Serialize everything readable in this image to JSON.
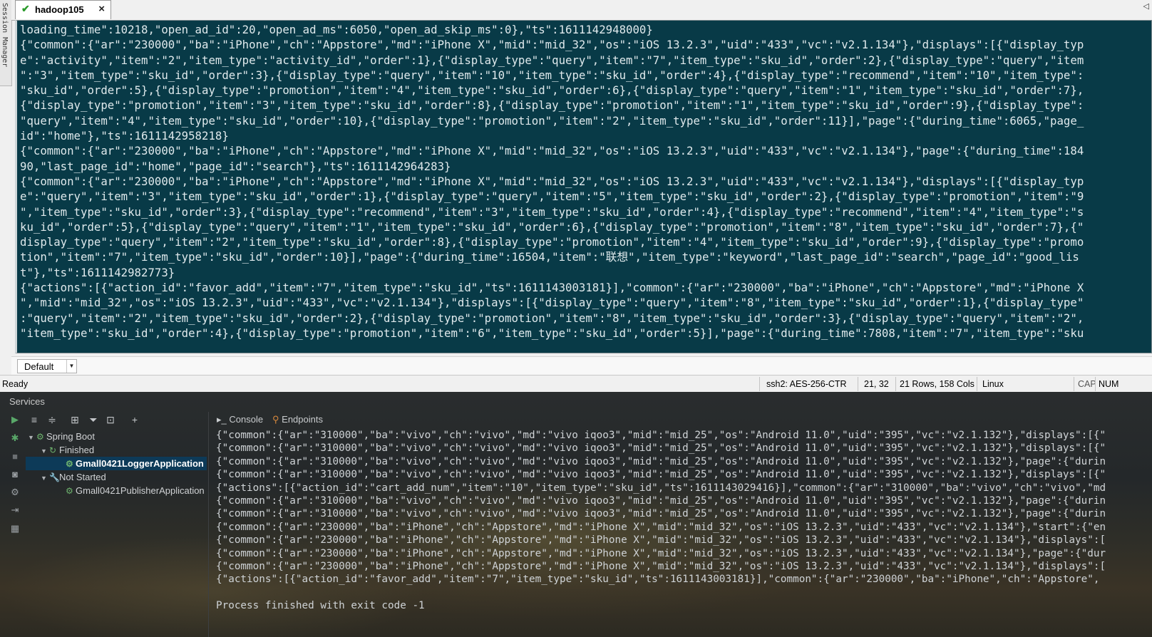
{
  "session_manager": {
    "label": "Session Manager"
  },
  "tab": {
    "title": "hadoop105"
  },
  "terminal": {
    "lines": [
      "loading_time\":10218,\"open_ad_id\":20,\"open_ad_ms\":6050,\"open_ad_skip_ms\":0},\"ts\":1611142948000}",
      "{\"common\":{\"ar\":\"230000\",\"ba\":\"iPhone\",\"ch\":\"Appstore\",\"md\":\"iPhone X\",\"mid\":\"mid_32\",\"os\":\"iOS 13.2.3\",\"uid\":\"433\",\"vc\":\"v2.1.134\"},\"displays\":[{\"display_typ",
      "e\":\"activity\",\"item\":\"2\",\"item_type\":\"activity_id\",\"order\":1},{\"display_type\":\"query\",\"item\":\"7\",\"item_type\":\"sku_id\",\"order\":2},{\"display_type\":\"query\",\"item",
      "\":\"3\",\"item_type\":\"sku_id\",\"order\":3},{\"display_type\":\"query\",\"item\":\"10\",\"item_type\":\"sku_id\",\"order\":4},{\"display_type\":\"recommend\",\"item\":\"10\",\"item_type\":",
      "\"sku_id\",\"order\":5},{\"display_type\":\"promotion\",\"item\":\"4\",\"item_type\":\"sku_id\",\"order\":6},{\"display_type\":\"query\",\"item\":\"1\",\"item_type\":\"sku_id\",\"order\":7},",
      "{\"display_type\":\"promotion\",\"item\":\"3\",\"item_type\":\"sku_id\",\"order\":8},{\"display_type\":\"promotion\",\"item\":\"1\",\"item_type\":\"sku_id\",\"order\":9},{\"display_type\":",
      "\"query\",\"item\":\"4\",\"item_type\":\"sku_id\",\"order\":10},{\"display_type\":\"promotion\",\"item\":\"2\",\"item_type\":\"sku_id\",\"order\":11}],\"page\":{\"during_time\":6065,\"page_",
      "id\":\"home\"},\"ts\":1611142958218}",
      "{\"common\":{\"ar\":\"230000\",\"ba\":\"iPhone\",\"ch\":\"Appstore\",\"md\":\"iPhone X\",\"mid\":\"mid_32\",\"os\":\"iOS 13.2.3\",\"uid\":\"433\",\"vc\":\"v2.1.134\"},\"page\":{\"during_time\":184",
      "90,\"last_page_id\":\"home\",\"page_id\":\"search\"},\"ts\":1611142964283}",
      "{\"common\":{\"ar\":\"230000\",\"ba\":\"iPhone\",\"ch\":\"Appstore\",\"md\":\"iPhone X\",\"mid\":\"mid_32\",\"os\":\"iOS 13.2.3\",\"uid\":\"433\",\"vc\":\"v2.1.134\"},\"displays\":[{\"display_typ",
      "e\":\"query\",\"item\":\"3\",\"item_type\":\"sku_id\",\"order\":1},{\"display_type\":\"query\",\"item\":\"5\",\"item_type\":\"sku_id\",\"order\":2},{\"display_type\":\"promotion\",\"item\":\"9",
      "\",\"item_type\":\"sku_id\",\"order\":3},{\"display_type\":\"recommend\",\"item\":\"3\",\"item_type\":\"sku_id\",\"order\":4},{\"display_type\":\"recommend\",\"item\":\"4\",\"item_type\":\"s",
      "ku_id\",\"order\":5},{\"display_type\":\"query\",\"item\":\"1\",\"item_type\":\"sku_id\",\"order\":6},{\"display_type\":\"promotion\",\"item\":\"8\",\"item_type\":\"sku_id\",\"order\":7},{\"",
      "display_type\":\"query\",\"item\":\"2\",\"item_type\":\"sku_id\",\"order\":8},{\"display_type\":\"promotion\",\"item\":\"4\",\"item_type\":\"sku_id\",\"order\":9},{\"display_type\":\"promo",
      "tion\",\"item\":\"7\",\"item_type\":\"sku_id\",\"order\":10}],\"page\":{\"during_time\":16504,\"item\":\"联想\",\"item_type\":\"keyword\",\"last_page_id\":\"search\",\"page_id\":\"good_lis",
      "t\"},\"ts\":1611142982773}",
      "{\"actions\":[{\"action_id\":\"favor_add\",\"item\":\"7\",\"item_type\":\"sku_id\",\"ts\":1611143003181}],\"common\":{\"ar\":\"230000\",\"ba\":\"iPhone\",\"ch\":\"Appstore\",\"md\":\"iPhone X",
      "\",\"mid\":\"mid_32\",\"os\":\"iOS 13.2.3\",\"uid\":\"433\",\"vc\":\"v2.1.134\"},\"displays\":[{\"display_type\":\"query\",\"item\":\"8\",\"item_type\":\"sku_id\",\"order\":1},{\"display_type\"",
      ":\"query\",\"item\":\"2\",\"item_type\":\"sku_id\",\"order\":2},{\"display_type\":\"promotion\",\"item\":\"8\",\"item_type\":\"sku_id\",\"order\":3},{\"display_type\":\"query\",\"item\":\"2\",",
      "\"item_type\":\"sku_id\",\"order\":4},{\"display_type\":\"promotion\",\"item\":\"6\",\"item_type\":\"sku_id\",\"order\":5}],\"page\":{\"during_time\":7808,\"item\":\"7\",\"item_type\":\"sku"
    ]
  },
  "command_bar": {
    "combo_value": "Default"
  },
  "status_bar": {
    "ready": "Ready",
    "cipher": "ssh2: AES-256-CTR",
    "cursor": "21,  32",
    "size": "21 Rows, 158 Cols",
    "os": "Linux",
    "cap": "CAP",
    "num": "NUM"
  },
  "services": {
    "title": "Services",
    "tabs": {
      "console": "Console",
      "endpoints": "Endpoints"
    },
    "tree": {
      "spring_boot": "Spring Boot",
      "finished": "Finished",
      "logger_app": "Gmall0421LoggerApplication",
      "not_started": "Not Started",
      "publisher_app": "Gmall0421PublisherApplication"
    },
    "console_lines": [
      "{\"common\":{\"ar\":\"310000\",\"ba\":\"vivo\",\"ch\":\"vivo\",\"md\":\"vivo iqoo3\",\"mid\":\"mid_25\",\"os\":\"Android 11.0\",\"uid\":\"395\",\"vc\":\"v2.1.132\"},\"displays\":[{\"",
      "{\"common\":{\"ar\":\"310000\",\"ba\":\"vivo\",\"ch\":\"vivo\",\"md\":\"vivo iqoo3\",\"mid\":\"mid_25\",\"os\":\"Android 11.0\",\"uid\":\"395\",\"vc\":\"v2.1.132\"},\"displays\":[{\"",
      "{\"common\":{\"ar\":\"310000\",\"ba\":\"vivo\",\"ch\":\"vivo\",\"md\":\"vivo iqoo3\",\"mid\":\"mid_25\",\"os\":\"Android 11.0\",\"uid\":\"395\",\"vc\":\"v2.1.132\"},\"page\":{\"durin",
      "{\"common\":{\"ar\":\"310000\",\"ba\":\"vivo\",\"ch\":\"vivo\",\"md\":\"vivo iqoo3\",\"mid\":\"mid_25\",\"os\":\"Android 11.0\",\"uid\":\"395\",\"vc\":\"v2.1.132\"},\"displays\":[{\"",
      "{\"actions\":[{\"action_id\":\"cart_add_num\",\"item\":\"10\",\"item_type\":\"sku_id\",\"ts\":1611143029416}],\"common\":{\"ar\":\"310000\",\"ba\":\"vivo\",\"ch\":\"vivo\",\"md",
      "{\"common\":{\"ar\":\"310000\",\"ba\":\"vivo\",\"ch\":\"vivo\",\"md\":\"vivo iqoo3\",\"mid\":\"mid_25\",\"os\":\"Android 11.0\",\"uid\":\"395\",\"vc\":\"v2.1.132\"},\"page\":{\"durin",
      "{\"common\":{\"ar\":\"310000\",\"ba\":\"vivo\",\"ch\":\"vivo\",\"md\":\"vivo iqoo3\",\"mid\":\"mid_25\",\"os\":\"Android 11.0\",\"uid\":\"395\",\"vc\":\"v2.1.132\"},\"page\":{\"durin",
      "{\"common\":{\"ar\":\"230000\",\"ba\":\"iPhone\",\"ch\":\"Appstore\",\"md\":\"iPhone X\",\"mid\":\"mid_32\",\"os\":\"iOS 13.2.3\",\"uid\":\"433\",\"vc\":\"v2.1.134\"},\"start\":{\"en",
      "{\"common\":{\"ar\":\"230000\",\"ba\":\"iPhone\",\"ch\":\"Appstore\",\"md\":\"iPhone X\",\"mid\":\"mid_32\",\"os\":\"iOS 13.2.3\",\"uid\":\"433\",\"vc\":\"v2.1.134\"},\"displays\":[",
      "{\"common\":{\"ar\":\"230000\",\"ba\":\"iPhone\",\"ch\":\"Appstore\",\"md\":\"iPhone X\",\"mid\":\"mid_32\",\"os\":\"iOS 13.2.3\",\"uid\":\"433\",\"vc\":\"v2.1.134\"},\"page\":{\"dur",
      "{\"common\":{\"ar\":\"230000\",\"ba\":\"iPhone\",\"ch\":\"Appstore\",\"md\":\"iPhone X\",\"mid\":\"mid_32\",\"os\":\"iOS 13.2.3\",\"uid\":\"433\",\"vc\":\"v2.1.134\"},\"displays\":[",
      "{\"actions\":[{\"action_id\":\"favor_add\",\"item\":\"7\",\"item_type\":\"sku_id\",\"ts\":1611143003181}],\"common\":{\"ar\":\"230000\",\"ba\":\"iPhone\",\"ch\":\"Appstore\",",
      "",
      "Process finished with exit code -1"
    ]
  }
}
